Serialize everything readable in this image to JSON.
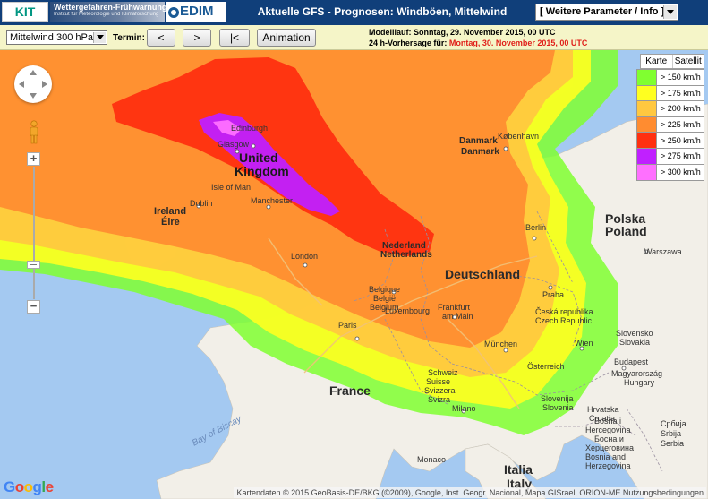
{
  "header": {
    "kit_logo": "KIT",
    "wfw_title": "Wettergefahren-Frühwarnung",
    "wfw_subtitle": "Institut für Meteorologie und Klimaforschung",
    "cedim_logo": "EDIM",
    "title": "Aktuelle GFS - Prognosen: Windböen, Mittelwind",
    "param_select": "[ Weitere Parameter / Info ]"
  },
  "toolbar": {
    "level_select": "Mittelwind 300 hPa",
    "termin_label": "Termin:",
    "prev_btn": "<",
    "next_btn": ">",
    "first_btn": "|<",
    "animation_btn": "Animation",
    "modelllauf": "Modelllauf: Sonntag, 29. November 2015, 00 UTC",
    "vorhersage_label": "24 h-Vorhersage für:",
    "vorhersage_value": "Montag, 30. November 2015, 00 UTC"
  },
  "map": {
    "type_buttons": [
      "Karte",
      "Satellit"
    ],
    "legend": [
      {
        "label": "> 150 km/h",
        "color": "#80ff30"
      },
      {
        "label": "> 175 km/h",
        "color": "#ffff20"
      },
      {
        "label": "> 200 km/h",
        "color": "#ffc840"
      },
      {
        "label": "> 225 km/h",
        "color": "#ff8c30"
      },
      {
        "label": "> 250 km/h",
        "color": "#ff3010"
      },
      {
        "label": "> 275 km/h",
        "color": "#c020ff"
      },
      {
        "label": "> 300 km/h",
        "color": "#ff70ff"
      }
    ],
    "labels": {
      "edinburgh": "Edinburgh",
      "glasgow": "Glasgow",
      "united": "United",
      "kingdom": "Kingdom",
      "isle_of_man": "Isle of Man",
      "ireland": "Ireland",
      "eire": "Éire",
      "dublin": "Dublin",
      "manchester": "Manchester",
      "london": "London",
      "danmark": "Danmark",
      "danmark2": "Danmark",
      "kobenhavn": "København",
      "nederland": "Nederland",
      "netherlands": "Netherlands",
      "deutschland": "Deutschland",
      "belgique": "Belgique",
      "belgie": "België",
      "belgium": "Belgium",
      "luxembourg": "Luxembourg",
      "frankfurt": "Frankfurt",
      "am_main": "am Main",
      "berlin": "Berlin",
      "praha": "Praha",
      "ceska": "Česká republika",
      "czech": "Czech Republic",
      "polska": "Polska",
      "poland": "Poland",
      "warszawa": "Warszawa",
      "munchen": "München",
      "wien": "Wien",
      "osterreich": "Österreich",
      "slovensko": "Slovensko",
      "slovakia": "Slovakia",
      "budapest": "Budapest",
      "magyarorszag": "Magyarország",
      "hungary": "Hungary",
      "paris": "Paris",
      "france": "France",
      "schweiz": "Schweiz",
      "suisse": "Suisse",
      "svizzera": "Svizzera",
      "svizra": "Svizra",
      "milano": "Milano",
      "slovenija": "Slovenija",
      "slovenia": "Slovenia",
      "hrvatska": "Hrvatska",
      "croatia": "Croatia",
      "bosna": "Bosna i",
      "hercegovina": "Hercegovina",
      "bosna_cyr": "Босна и",
      "hercegovina_cyr": "Херцеговина",
      "bosnia": "Bosnia and",
      "herzegovina": "Herzegovina",
      "srbija_cyr": "Србија",
      "srbija": "Srbija",
      "serbia": "Serbia",
      "bay_of_biscay": "Bay of Biscay",
      "monaco": "Monaco",
      "italia": "Italia",
      "italy": "Italy"
    },
    "google": [
      "G",
      "o",
      "o",
      "g",
      "l",
      "e"
    ],
    "credit": "Kartendaten © 2015 GeoBasis-DE/BKG (©2009), Google, Inst. Geogr. Nacional, Mapa GISrael, ORION-ME  Nutzungsbedingungen"
  }
}
